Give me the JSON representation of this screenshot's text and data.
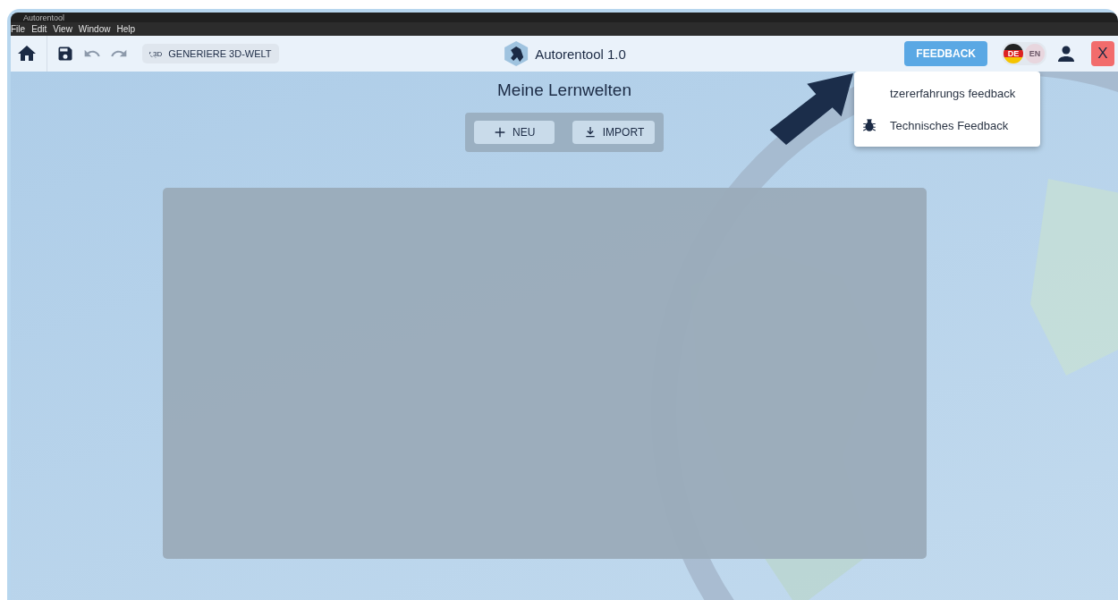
{
  "window": {
    "title": "Autorentool"
  },
  "menu_bar": [
    "File",
    "Edit",
    "View",
    "Window",
    "Help"
  ],
  "toolbar": {
    "generate_button": {
      "badge": "3D",
      "label": "GENERIERE 3D-WELT"
    },
    "app_title": "Autorentool 1.0",
    "feedback_button": "FEEDBACK",
    "languages": [
      {
        "label": "DE",
        "selected": true
      },
      {
        "label": "EN",
        "selected": false
      }
    ],
    "close_button": "X"
  },
  "page_title": "Meine Lernwelten",
  "actions": [
    {
      "kind": "new",
      "label": "NEU"
    },
    {
      "kind": "import",
      "label": "IMPORT"
    }
  ],
  "feedback_menu": [
    {
      "kind": "hidden-icon",
      "label": "tzererfahrungs feedback"
    },
    {
      "kind": "bug",
      "label": "Technisches Feedback"
    }
  ]
}
